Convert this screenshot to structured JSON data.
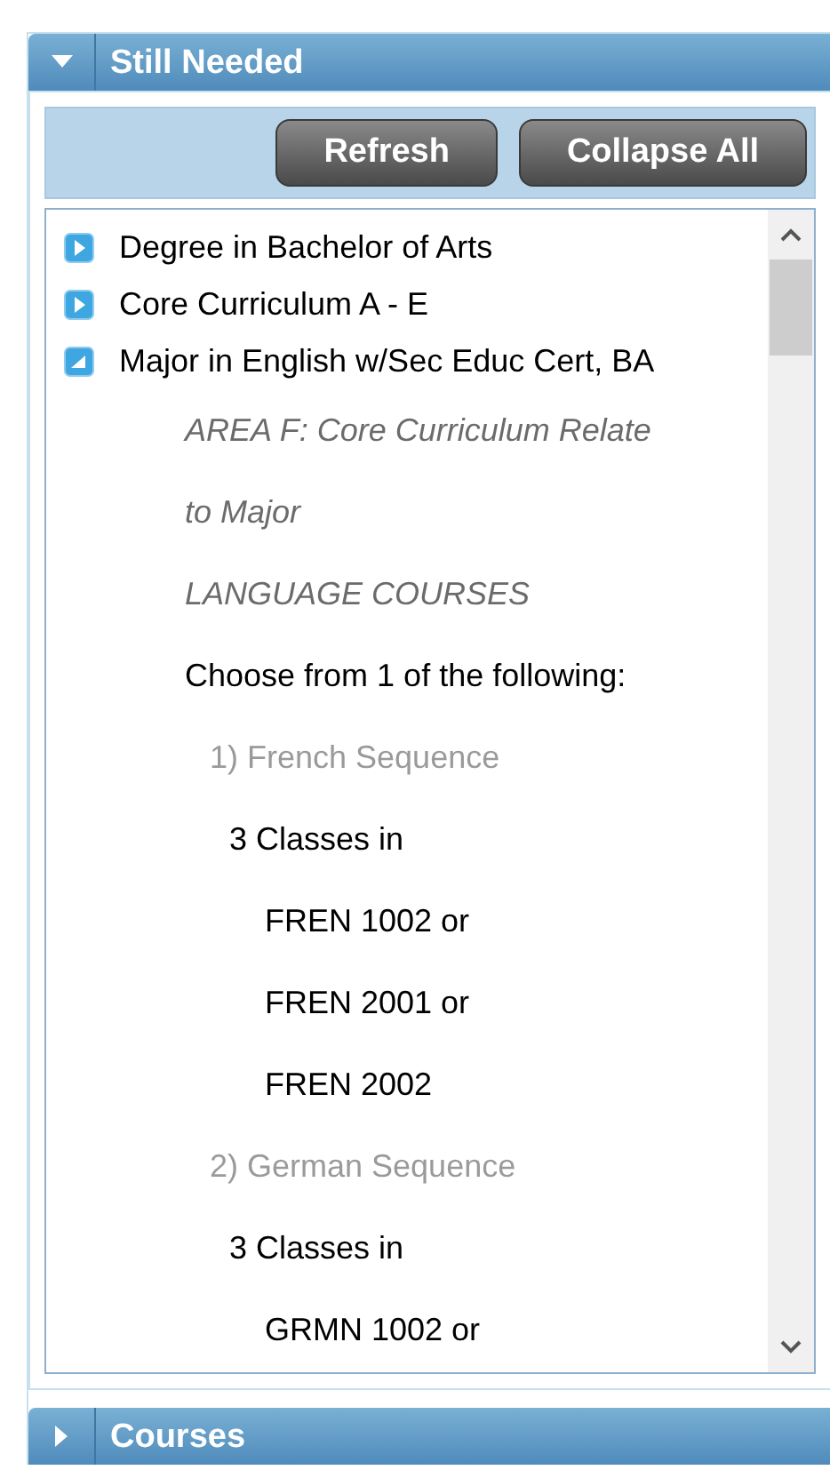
{
  "sections": [
    {
      "title": "Still Needed",
      "expanded": true
    },
    {
      "title": "Courses",
      "expanded": false
    }
  ],
  "toolbar": {
    "buttons": [
      "Refresh",
      "Collapse All"
    ]
  },
  "tree": [
    {
      "label": "Degree in Bachelor of Arts",
      "expanded": false
    },
    {
      "label": "Core Curriculum A - E",
      "expanded": false
    },
    {
      "label": "Major in English w/Sec Educ Cert, BA",
      "expanded": true,
      "children": [
        {
          "kind": "heading",
          "text": "AREA F: Core Curriculum Relate"
        },
        {
          "kind": "heading",
          "text": "to Major"
        },
        {
          "kind": "heading",
          "text": "LANGUAGE COURSES"
        },
        {
          "kind": "instruction",
          "text": "Choose from 1 of the following:"
        },
        {
          "kind": "option",
          "text": "1) French Sequence"
        },
        {
          "kind": "count",
          "text": "3 Classes in"
        },
        {
          "kind": "course",
          "text": "FREN 1002 or"
        },
        {
          "kind": "course",
          "text": "FREN 2001 or"
        },
        {
          "kind": "course",
          "text": "FREN 2002"
        },
        {
          "kind": "option",
          "text": "2) German Sequence"
        },
        {
          "kind": "count",
          "text": "3 Classes in"
        },
        {
          "kind": "course",
          "text": "GRMN 1002 or"
        }
      ]
    }
  ]
}
